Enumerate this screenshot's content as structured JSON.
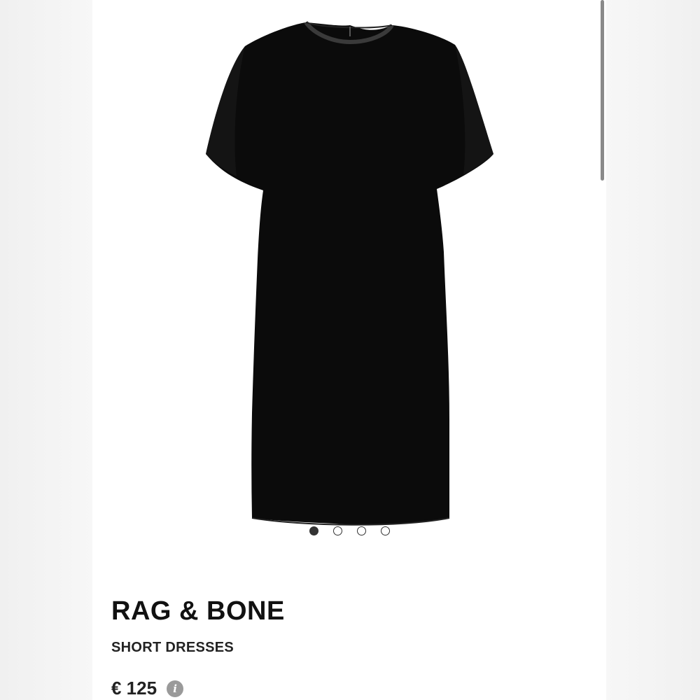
{
  "product": {
    "brand": "RAG & BONE",
    "category": "SHORT DRESSES",
    "price": "€ 125",
    "image_alt": "black short dress"
  },
  "gallery": {
    "image_count": 4,
    "active_index": 0
  },
  "icons": {
    "info": "info-icon"
  },
  "colors": {
    "dress": "#0b0b0b",
    "text": "#111111",
    "info_icon": "#9a9a9a",
    "dot_active": "#333333"
  }
}
